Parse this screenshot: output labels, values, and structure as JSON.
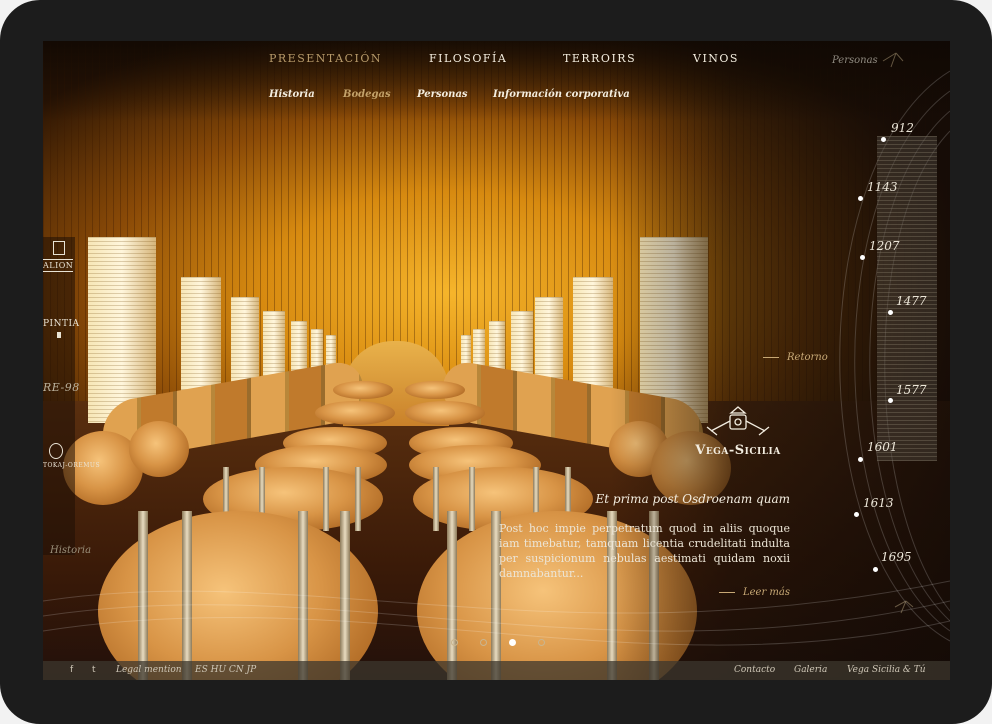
{
  "main_nav": {
    "items": [
      {
        "label": "Presentación",
        "active": true
      },
      {
        "label": "Filosofía",
        "active": false
      },
      {
        "label": "Terroirs",
        "active": false
      },
      {
        "label": "Vinos",
        "active": false
      }
    ]
  },
  "sub_nav": {
    "items": [
      {
        "label": "Historia",
        "active": false
      },
      {
        "label": "Bodegas",
        "active": true
      },
      {
        "label": "Personas",
        "active": false
      },
      {
        "label": "Información corporativa",
        "active": false
      }
    ]
  },
  "top_right_link": "Personas",
  "timeline": {
    "years": [
      "912",
      "1143",
      "1207",
      "1477",
      "1577",
      "1601",
      "1613",
      "1695"
    ]
  },
  "retorno_label": "Retorno",
  "left_brands": [
    "ALION",
    "PINTIA",
    "RE-98",
    "TOKAJ-OREMUS"
  ],
  "historia_label": "Historia",
  "feature": {
    "brand_name": "Vega-Sicilia",
    "headline": "Et prima post Osdroenam quam",
    "body": "Post hoc impie perpetratum quod in aliis quoque iam timebatur, tamquam licentia crudelitati indulta per suspicionum nebulas aestimati quidam noxii damnabantur...",
    "read_more": "Leer más"
  },
  "pager": {
    "count": 4,
    "active": 2
  },
  "footer": {
    "social_facebook": "f",
    "social_twitter": "t",
    "legal": "Legal mention",
    "languages": "ES HU CN JP",
    "links": [
      "Contacto",
      "Galeria",
      "Vega Sicilia & Tú"
    ]
  },
  "colors": {
    "accent": "#c7a875",
    "nav_text": "#f4eee0",
    "active_nav": "#b79a6a"
  }
}
